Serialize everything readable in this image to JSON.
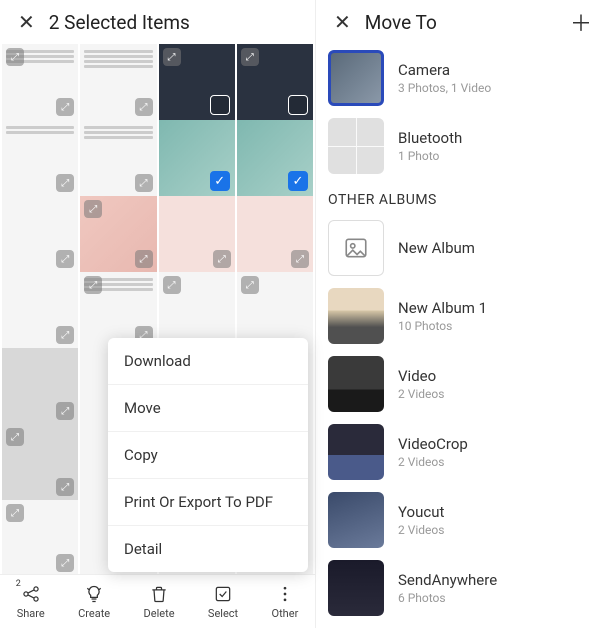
{
  "left": {
    "title": "2 Selected Items",
    "popup": {
      "download": "Download",
      "move": "Move",
      "copy": "Copy",
      "print": "Print Or Export To PDF",
      "detail": "Detail"
    },
    "toolbar": {
      "share": "Share",
      "create": "Create",
      "delete": "Delete",
      "select": "Select",
      "other": "Other",
      "share_badge": "2"
    }
  },
  "right": {
    "title": "Move To",
    "albums": {
      "camera": {
        "name": "Camera",
        "meta": "3 Photos, 1 Video"
      },
      "bluetooth": {
        "name": "Bluetooth",
        "meta": "1 Photo"
      },
      "section_other": "OTHER ALBUMS",
      "newalbum": {
        "name": "New Album"
      },
      "newalbum1": {
        "name": "New Album 1",
        "meta": "10 Photos"
      },
      "video": {
        "name": "Video",
        "meta": "2 Videos"
      },
      "videocrop": {
        "name": "VideoCrop",
        "meta": "2 Videos"
      },
      "youcut": {
        "name": "Youcut",
        "meta": "2 Videos"
      },
      "sendanywhere": {
        "name": "SendAnywhere",
        "meta": "6 Photos"
      }
    }
  }
}
